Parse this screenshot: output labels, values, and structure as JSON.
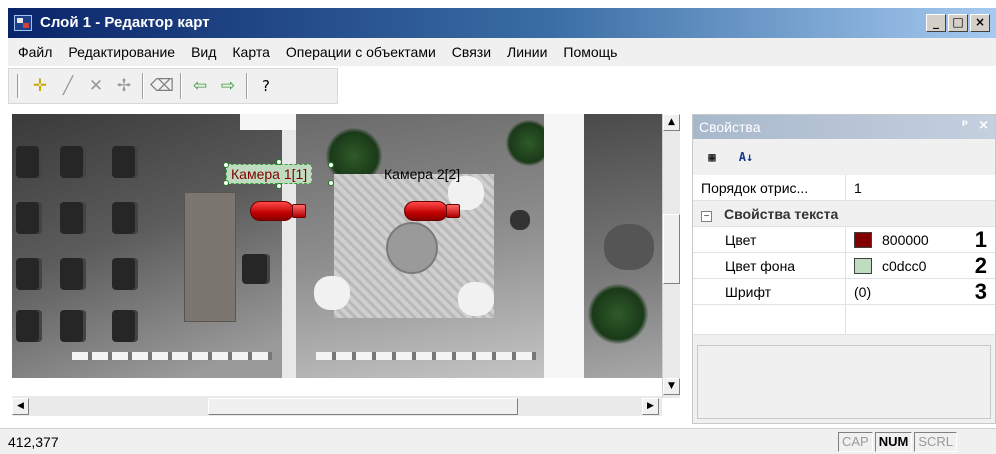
{
  "window": {
    "title": "Слой 1 - Редактор карт",
    "controls": {
      "minimize": "_",
      "maximize": "□",
      "close": "×"
    }
  },
  "menu": [
    "Файл",
    "Редактирование",
    "Вид",
    "Карта",
    "Операции с объектами",
    "Связи",
    "Линии",
    "Помощь"
  ],
  "toolbar": {
    "buttons": [
      {
        "icon": "add-object-icon",
        "glyph": "✛"
      },
      {
        "icon": "draw-line-icon",
        "glyph": "╱"
      },
      {
        "icon": "delete-icon",
        "glyph": "✕"
      },
      {
        "icon": "edit-points-icon",
        "glyph": "✢"
      },
      {
        "icon": "eraser-icon",
        "glyph": "⌫"
      },
      {
        "icon": "undo-icon",
        "glyph": "⇦"
      },
      {
        "icon": "redo-icon",
        "glyph": "⇨"
      },
      {
        "icon": "help-icon",
        "glyph": "?"
      }
    ]
  },
  "map": {
    "cameras": [
      {
        "label": "Камера 1[1]",
        "selected": true
      },
      {
        "label": "Камера 2[2]",
        "selected": false
      }
    ]
  },
  "properties": {
    "title": "Свойства",
    "pin_glyph": "ᵖ",
    "close_glyph": "×",
    "tools": {
      "categorized": "▦",
      "alphabetical": "A↓"
    },
    "rows": {
      "order_name": "Порядок отрис...",
      "order_value": "1",
      "category": "Свойства текста",
      "category_toggle": "−",
      "color_name": "Цвет",
      "color_value": "800000",
      "color_hex": "#800000",
      "color_num": "1",
      "bg_name": "Цвет фона",
      "bg_value": "c0dcc0",
      "bg_hex": "#c0dcc0",
      "bg_num": "2",
      "font_name": "Шрифт",
      "font_value": "(0)",
      "font_num": "3"
    }
  },
  "status": {
    "coords": "412,377",
    "indicators": {
      "cap": "CAP",
      "num": "NUM",
      "scrl": "SCRL"
    }
  }
}
